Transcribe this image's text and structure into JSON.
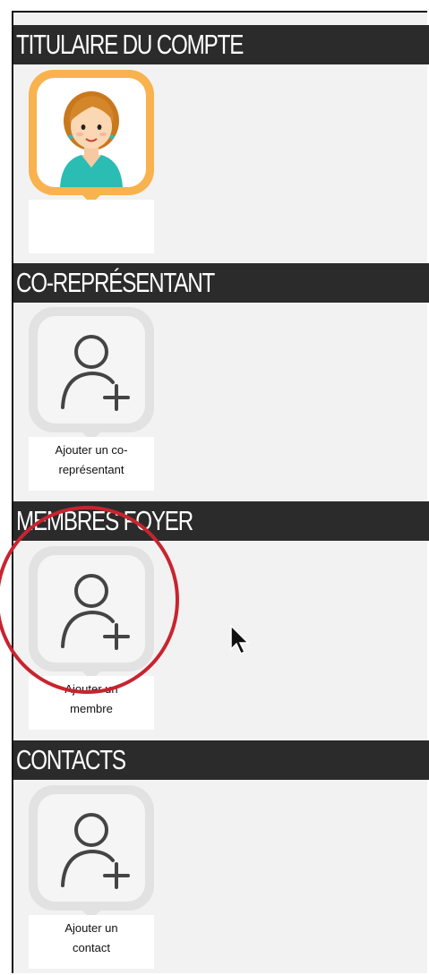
{
  "sections": {
    "account_holder": {
      "title": "TITULAIRE DU COMPTE",
      "caption": ""
    },
    "co_representative": {
      "title": "CO-REPRÉSENTANT",
      "caption_line1": "Ajouter un co-",
      "caption_line2": "représentant"
    },
    "household_members": {
      "title": "MEMBRES FOYER",
      "caption_line1": "Ajouter un",
      "caption_line2": "membre"
    },
    "contacts": {
      "title": "CONTACTS",
      "caption_line1": "Ajouter un",
      "caption_line2": "contact"
    }
  },
  "colors": {
    "header_bg": "#2b2b2b",
    "selected_border": "#f8b24e",
    "tile_gray": "#e2e2e2",
    "highlight_circle": "#c8242f"
  },
  "icons": {
    "avatar": "female-avatar-icon",
    "add": "add-user-icon",
    "cursor": "mouse-pointer-icon"
  }
}
